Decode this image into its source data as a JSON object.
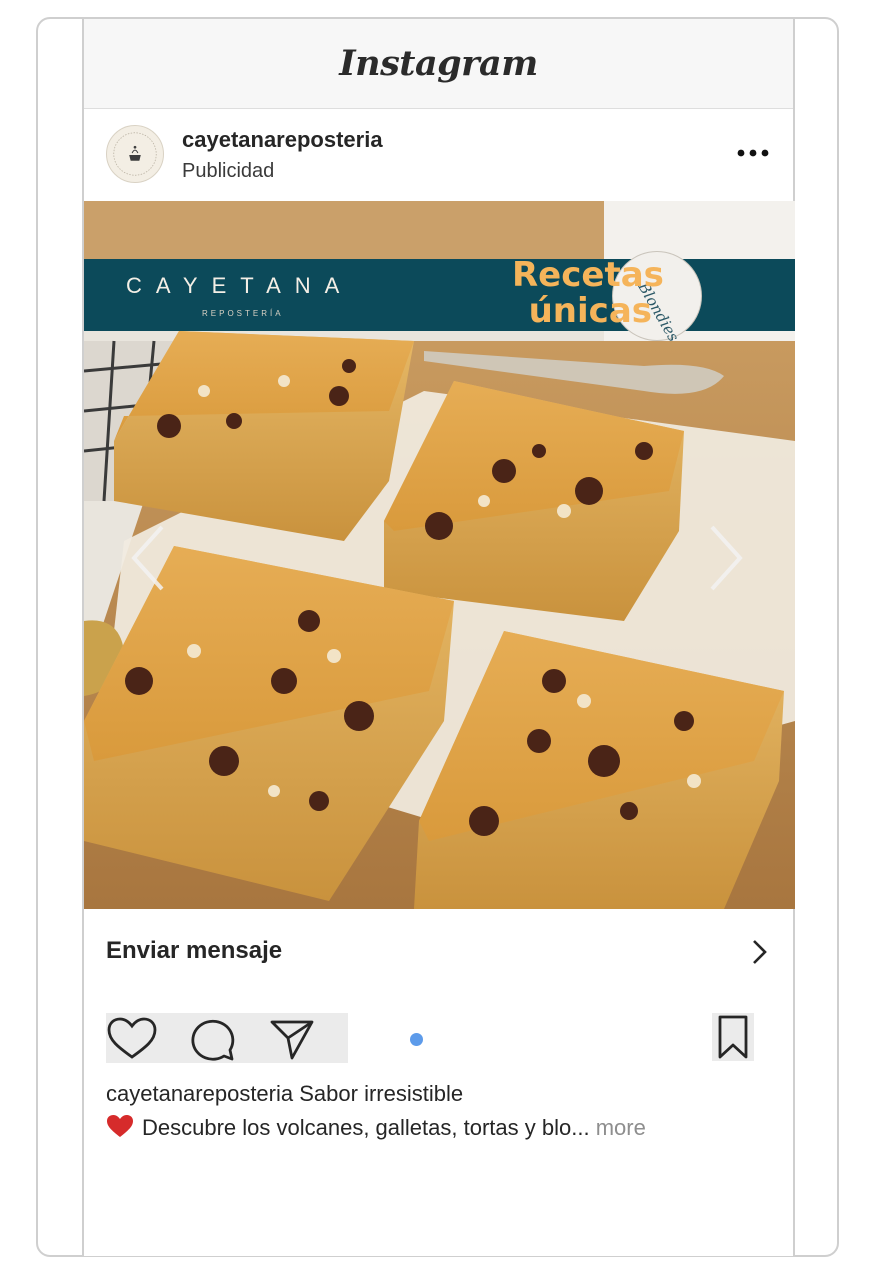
{
  "app": {
    "title": "Instagram"
  },
  "post": {
    "username": "cayetanareposteria",
    "sponsored_label": "Publicidad",
    "more_icon": "ellipsis-icon"
  },
  "image": {
    "brand_name": "CAYETANA",
    "brand_sub": "REPOSTERÍA",
    "headline_line1": "Recetas",
    "headline_line2": "únicas",
    "circle_label": "Blondies",
    "colors": {
      "banner": "#0c4a5a",
      "headline": "#f5b45a"
    }
  },
  "cta": {
    "label": "Enviar mensaje",
    "icon": "chevron-right-icon"
  },
  "actions": {
    "icons": [
      "heart-icon",
      "comment-icon",
      "share-icon",
      "bookmark-icon"
    ],
    "carousel_dot_color": "#5d9bea"
  },
  "caption": {
    "username": "cayetanareposteria",
    "text1": "Sabor irresistible",
    "text2": "Descubre los volcanes, galletas, tortas y blo...",
    "more": "more"
  }
}
